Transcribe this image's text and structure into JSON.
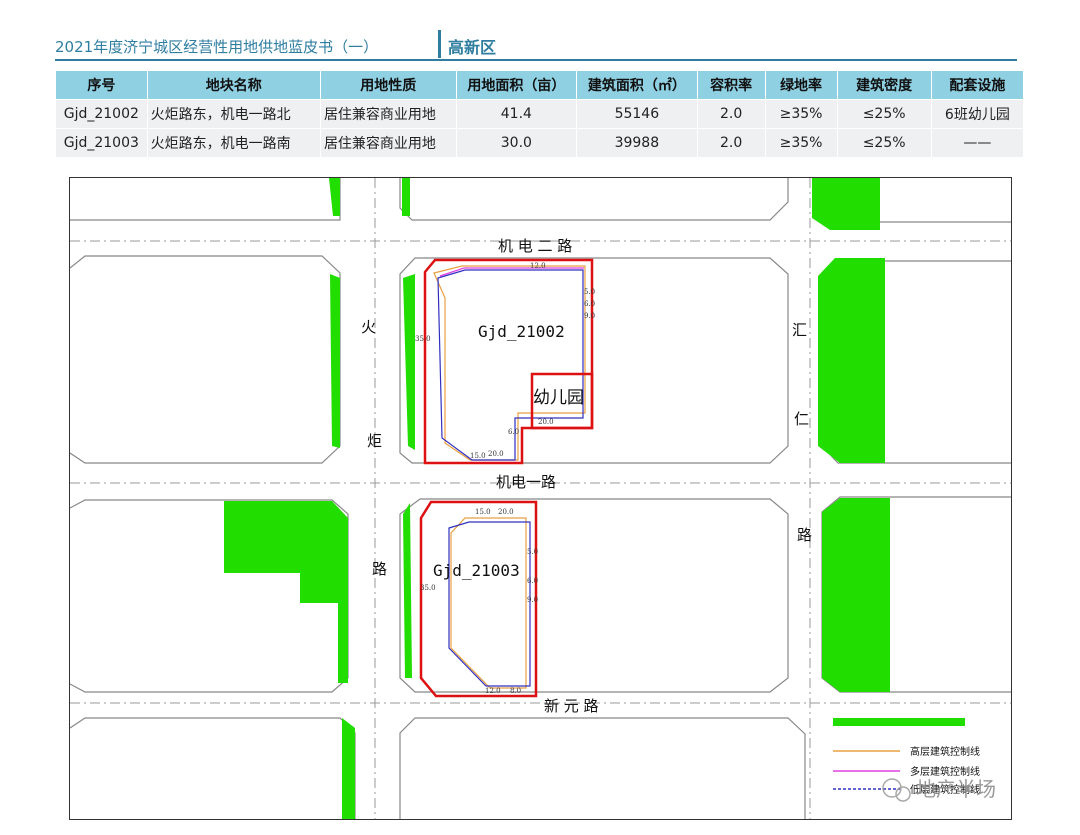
{
  "header": {
    "subtitle": "2021年度济宁城区经营性用地供地蓝皮书（一）",
    "zone": "高新区"
  },
  "table": {
    "headers": [
      "序号",
      "地块名称",
      "用地性质",
      "用地面积（亩）",
      "建筑面积（㎡）",
      "容积率",
      "绿地率",
      "建筑密度",
      "配套设施"
    ],
    "rows": [
      [
        "Gjd_21002",
        "火炬路东，机电一路北",
        "居住兼容商业用地",
        "41.4",
        "55146",
        "2.0",
        "≥35%",
        "≤25%",
        "6班幼儿园"
      ],
      [
        "Gjd_21003",
        "火炬路东，机电一路南",
        "居住兼容商业用地",
        "30.0",
        "39988",
        "2.0",
        "≥35%",
        "≤25%",
        "——"
      ]
    ]
  },
  "map": {
    "roads": {
      "jidian2": "机  电  二  路",
      "jidian1": "机电一路",
      "xinyuan": "新    元    路",
      "huoju": [
        "火",
        "炬",
        "路"
      ],
      "huiren": [
        "汇",
        "仁",
        "路"
      ]
    },
    "parcels": {
      "p1": "Gjd_21002",
      "p2": "Gjd_21003",
      "kindergarten": "幼儿园"
    },
    "dims": {
      "p1_west": "35.0",
      "p1_north": "12.0",
      "p1_east_a": "5.0",
      "p1_east_b": "6.0",
      "p1_east_c": "9.0",
      "p1_sw": "15.0",
      "p1_s1": "20.0",
      "p1_s2": "6.0",
      "p1_s3": "20.0",
      "p2_west": "35.0",
      "p2_n1": "15.0",
      "p2_n2": "20.0",
      "p2_e1": "5.0",
      "p2_e2": "6.0",
      "p2_e3": "9.0",
      "p2_s1": "12.0",
      "p2_s2": "8.0"
    },
    "legend": {
      "high": "高层建筑控制线",
      "multi": "多层建筑控制线",
      "low": "低层建筑控制线",
      "colors": {
        "high": "#e8a040",
        "multi": "#e040e0",
        "low": "#3030c0",
        "green": "#22dd00",
        "boundary": "#dd1111"
      }
    },
    "watermark": "地产半场"
  }
}
